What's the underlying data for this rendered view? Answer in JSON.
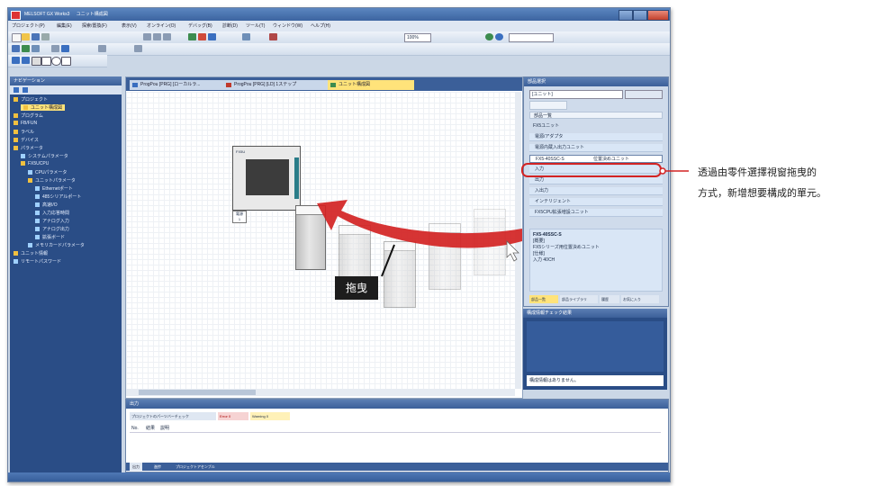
{
  "window": {
    "title_main": "MELSOFT GX Works3",
    "title_sub": "ユニット構成図",
    "menu": [
      "プロジェクト(P)",
      "編集(E)",
      "探索/置換(F)",
      "表示(V)",
      "オンライン(O)",
      "デバッグ(B)",
      "診断(D)",
      "ツール(T)",
      "ウィンドウ(W)",
      "ヘルプ(H)"
    ],
    "zoom": "100%"
  },
  "navigation": {
    "header": "ナビゲーション",
    "items": [
      {
        "label": "プロジェクト",
        "level": 0,
        "selected": false,
        "color": "#f0c040"
      },
      {
        "label": "ユニット構成図",
        "level": 1,
        "selected": true,
        "color": "#f0c040"
      },
      {
        "label": "プログラム",
        "level": 0,
        "selected": false,
        "color": "#f0c040"
      },
      {
        "label": "FB/FUN",
        "level": 0,
        "selected": false,
        "color": "#f0c040"
      },
      {
        "label": "ラベル",
        "level": 0,
        "selected": false,
        "color": "#f0c040"
      },
      {
        "label": "デバイス",
        "level": 0,
        "selected": false,
        "color": "#f0c040"
      },
      {
        "label": "パラメータ",
        "level": 0,
        "selected": false,
        "color": "#f0c040"
      },
      {
        "label": "システムパラメータ",
        "level": 1,
        "selected": false,
        "color": "#9fd0ff"
      },
      {
        "label": "FX5UCPU",
        "level": 1,
        "selected": false,
        "color": "#f0c040"
      },
      {
        "label": "CPUパラメータ",
        "level": 2,
        "selected": false,
        "color": "#9fd0ff"
      },
      {
        "label": "ユニットパラメータ",
        "level": 2,
        "selected": false,
        "color": "#f0c040"
      },
      {
        "label": "Ethernetポート",
        "level": 3,
        "selected": false,
        "color": "#9fd0ff"
      },
      {
        "label": "485シリアルポート",
        "level": 3,
        "selected": false,
        "color": "#9fd0ff"
      },
      {
        "label": "高速I/O",
        "level": 3,
        "selected": false,
        "color": "#9fd0ff"
      },
      {
        "label": "入力応答時間",
        "level": 3,
        "selected": false,
        "color": "#9fd0ff"
      },
      {
        "label": "アナログ入力",
        "level": 3,
        "selected": false,
        "color": "#9fd0ff"
      },
      {
        "label": "アナログ出力",
        "level": 3,
        "selected": false,
        "color": "#9fd0ff"
      },
      {
        "label": "拡張ボード",
        "level": 3,
        "selected": false,
        "color": "#9fd0ff"
      },
      {
        "label": "メモリカードパラメータ",
        "level": 2,
        "selected": false,
        "color": "#9fd0ff"
      },
      {
        "label": "ユニット情報",
        "level": 0,
        "selected": false,
        "color": "#f0c040"
      },
      {
        "label": "リモートパスワード",
        "level": 0,
        "selected": false,
        "color": "#9fd0ff"
      }
    ]
  },
  "editor": {
    "tabs": [
      {
        "label": "ProgPou [PRG] [ローカルラ...",
        "active": false
      },
      {
        "label": "ProgPou [PRG] [LD] 1ステップ",
        "active": false
      },
      {
        "label": "ユニット構成図",
        "active": true
      }
    ],
    "cpu_label": "FX5U",
    "cpu_caption": "電源",
    "cpu_caption2": "1"
  },
  "parts_panel": {
    "header": "部品選択",
    "search_value": "[ユニット]",
    "list_header": "部品一覧",
    "category": "FX5ユニット",
    "items": [
      {
        "label": "電源/アダプタ",
        "selected": false
      },
      {
        "label": "電源内蔵入出力ユニット",
        "selected": false
      },
      {
        "label": "FX5-40SSC-S",
        "selected": true,
        "desc": "位置決めユニット"
      },
      {
        "label": "入力",
        "selected": false
      },
      {
        "label": "出力",
        "selected": false
      },
      {
        "label": "入出力",
        "selected": false
      },
      {
        "label": "インテリジェント",
        "selected": false
      },
      {
        "label": "FX5CPU拡張増設ユニット",
        "selected": false
      }
    ],
    "detail_title": "FX5-40SSC-S",
    "detail_lines": [
      "[概要]",
      "FX5シリーズ用位置決めユニット",
      "[仕様]",
      "入力 40CH"
    ],
    "bottom_tabs": [
      "部品一覧",
      "部品ライブラリ",
      "履歴",
      "お気に入り"
    ]
  },
  "info_panel": {
    "header": "構成情報チェック結果",
    "message": "構成情報はありません。"
  },
  "output_panel": {
    "header": "出力",
    "tabs": [
      "プロジェクトのパーツバーチェック",
      "Error 0",
      "Warning 0"
    ],
    "columns": [
      "No.",
      "結果",
      "説明"
    ],
    "bottom_tabs": [
      "出力",
      "進捗",
      "プロジェクトアセンブル"
    ]
  },
  "annotations": {
    "drag_label": "拖曳",
    "note_line1": "透過由零件選擇視窗拖曳的",
    "note_line2": "方式，新增想要構成的單元。",
    "accent_color": "#d32323"
  }
}
